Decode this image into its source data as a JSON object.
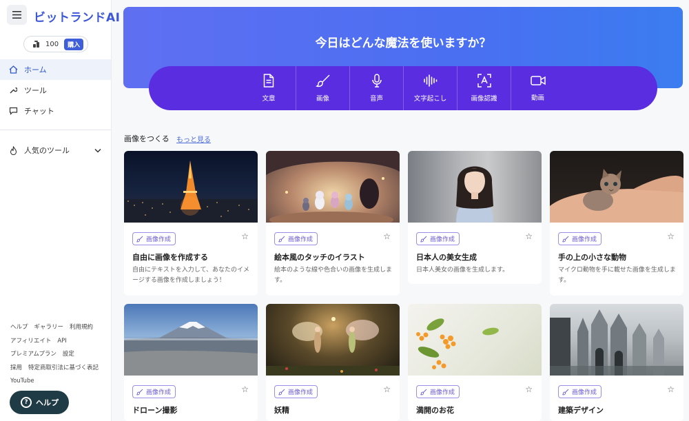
{
  "app": {
    "brand": "ビットランドAI"
  },
  "sidebar": {
    "credits": {
      "value": "100",
      "buy_label": "購入"
    },
    "nav": [
      {
        "label": "ホーム",
        "icon": "home-icon",
        "active": true
      },
      {
        "label": "ツール",
        "icon": "wrench-icon"
      },
      {
        "label": "チャット",
        "icon": "chat-icon"
      }
    ],
    "popular_tools": {
      "label": "人気のツール",
      "icon": "flame-icon"
    },
    "footer_links": [
      "ヘルプ",
      "ギャラリー",
      "利用規約",
      "アフィリエイト",
      "API",
      "プレミアムプラン",
      "設定",
      "採用",
      "特定商取引法に基づく表記",
      "YouTube"
    ],
    "help_button": {
      "label": "ヘルプ"
    }
  },
  "hero": {
    "title": "今日はどんな魔法を使いますか？",
    "tools": [
      {
        "label": "文章",
        "icon": "document-icon"
      },
      {
        "label": "画像",
        "icon": "brush-icon"
      },
      {
        "label": "音声",
        "icon": "microphone-icon"
      },
      {
        "label": "文字起こし",
        "icon": "waveform-icon"
      },
      {
        "label": "画像認識",
        "icon": "image-recognition-icon"
      },
      {
        "label": "動画",
        "icon": "video-icon"
      }
    ]
  },
  "section": {
    "title": "画像をつくる",
    "more": "もっと見る"
  },
  "cards": [
    {
      "badge": "画像作成",
      "title": "自由に画像を作成する",
      "desc": "自由にテキストを入力して、あなたのイメージする画像を作成しましょう！",
      "image": "tokyo-tower-night"
    },
    {
      "badge": "画像作成",
      "title": "絵本風のタッチのイラスト",
      "desc": "絵本のような線や色合いの画像を生成します。",
      "image": "picture-book-cave"
    },
    {
      "badge": "画像作成",
      "title": "日本人の美女生成",
      "desc": "日本人美女の画像を生成します。",
      "image": "portrait-woman"
    },
    {
      "badge": "画像作成",
      "title": "手の上の小さな動物",
      "desc": "マイクロ動物を手に載せた画像を生成します。",
      "image": "kitten-on-hand"
    },
    {
      "badge": "画像作成",
      "title": "ドローン撮影",
      "desc": "",
      "image": "mount-fuji-aerial"
    },
    {
      "badge": "画像作成",
      "title": "妖精",
      "desc": "",
      "image": "fairies"
    },
    {
      "badge": "画像作成",
      "title": "満開のお花",
      "desc": "",
      "image": "osmanthus-flowers"
    },
    {
      "badge": "画像作成",
      "title": "建築デザイン",
      "desc": "",
      "image": "gothic-architecture"
    }
  ]
}
